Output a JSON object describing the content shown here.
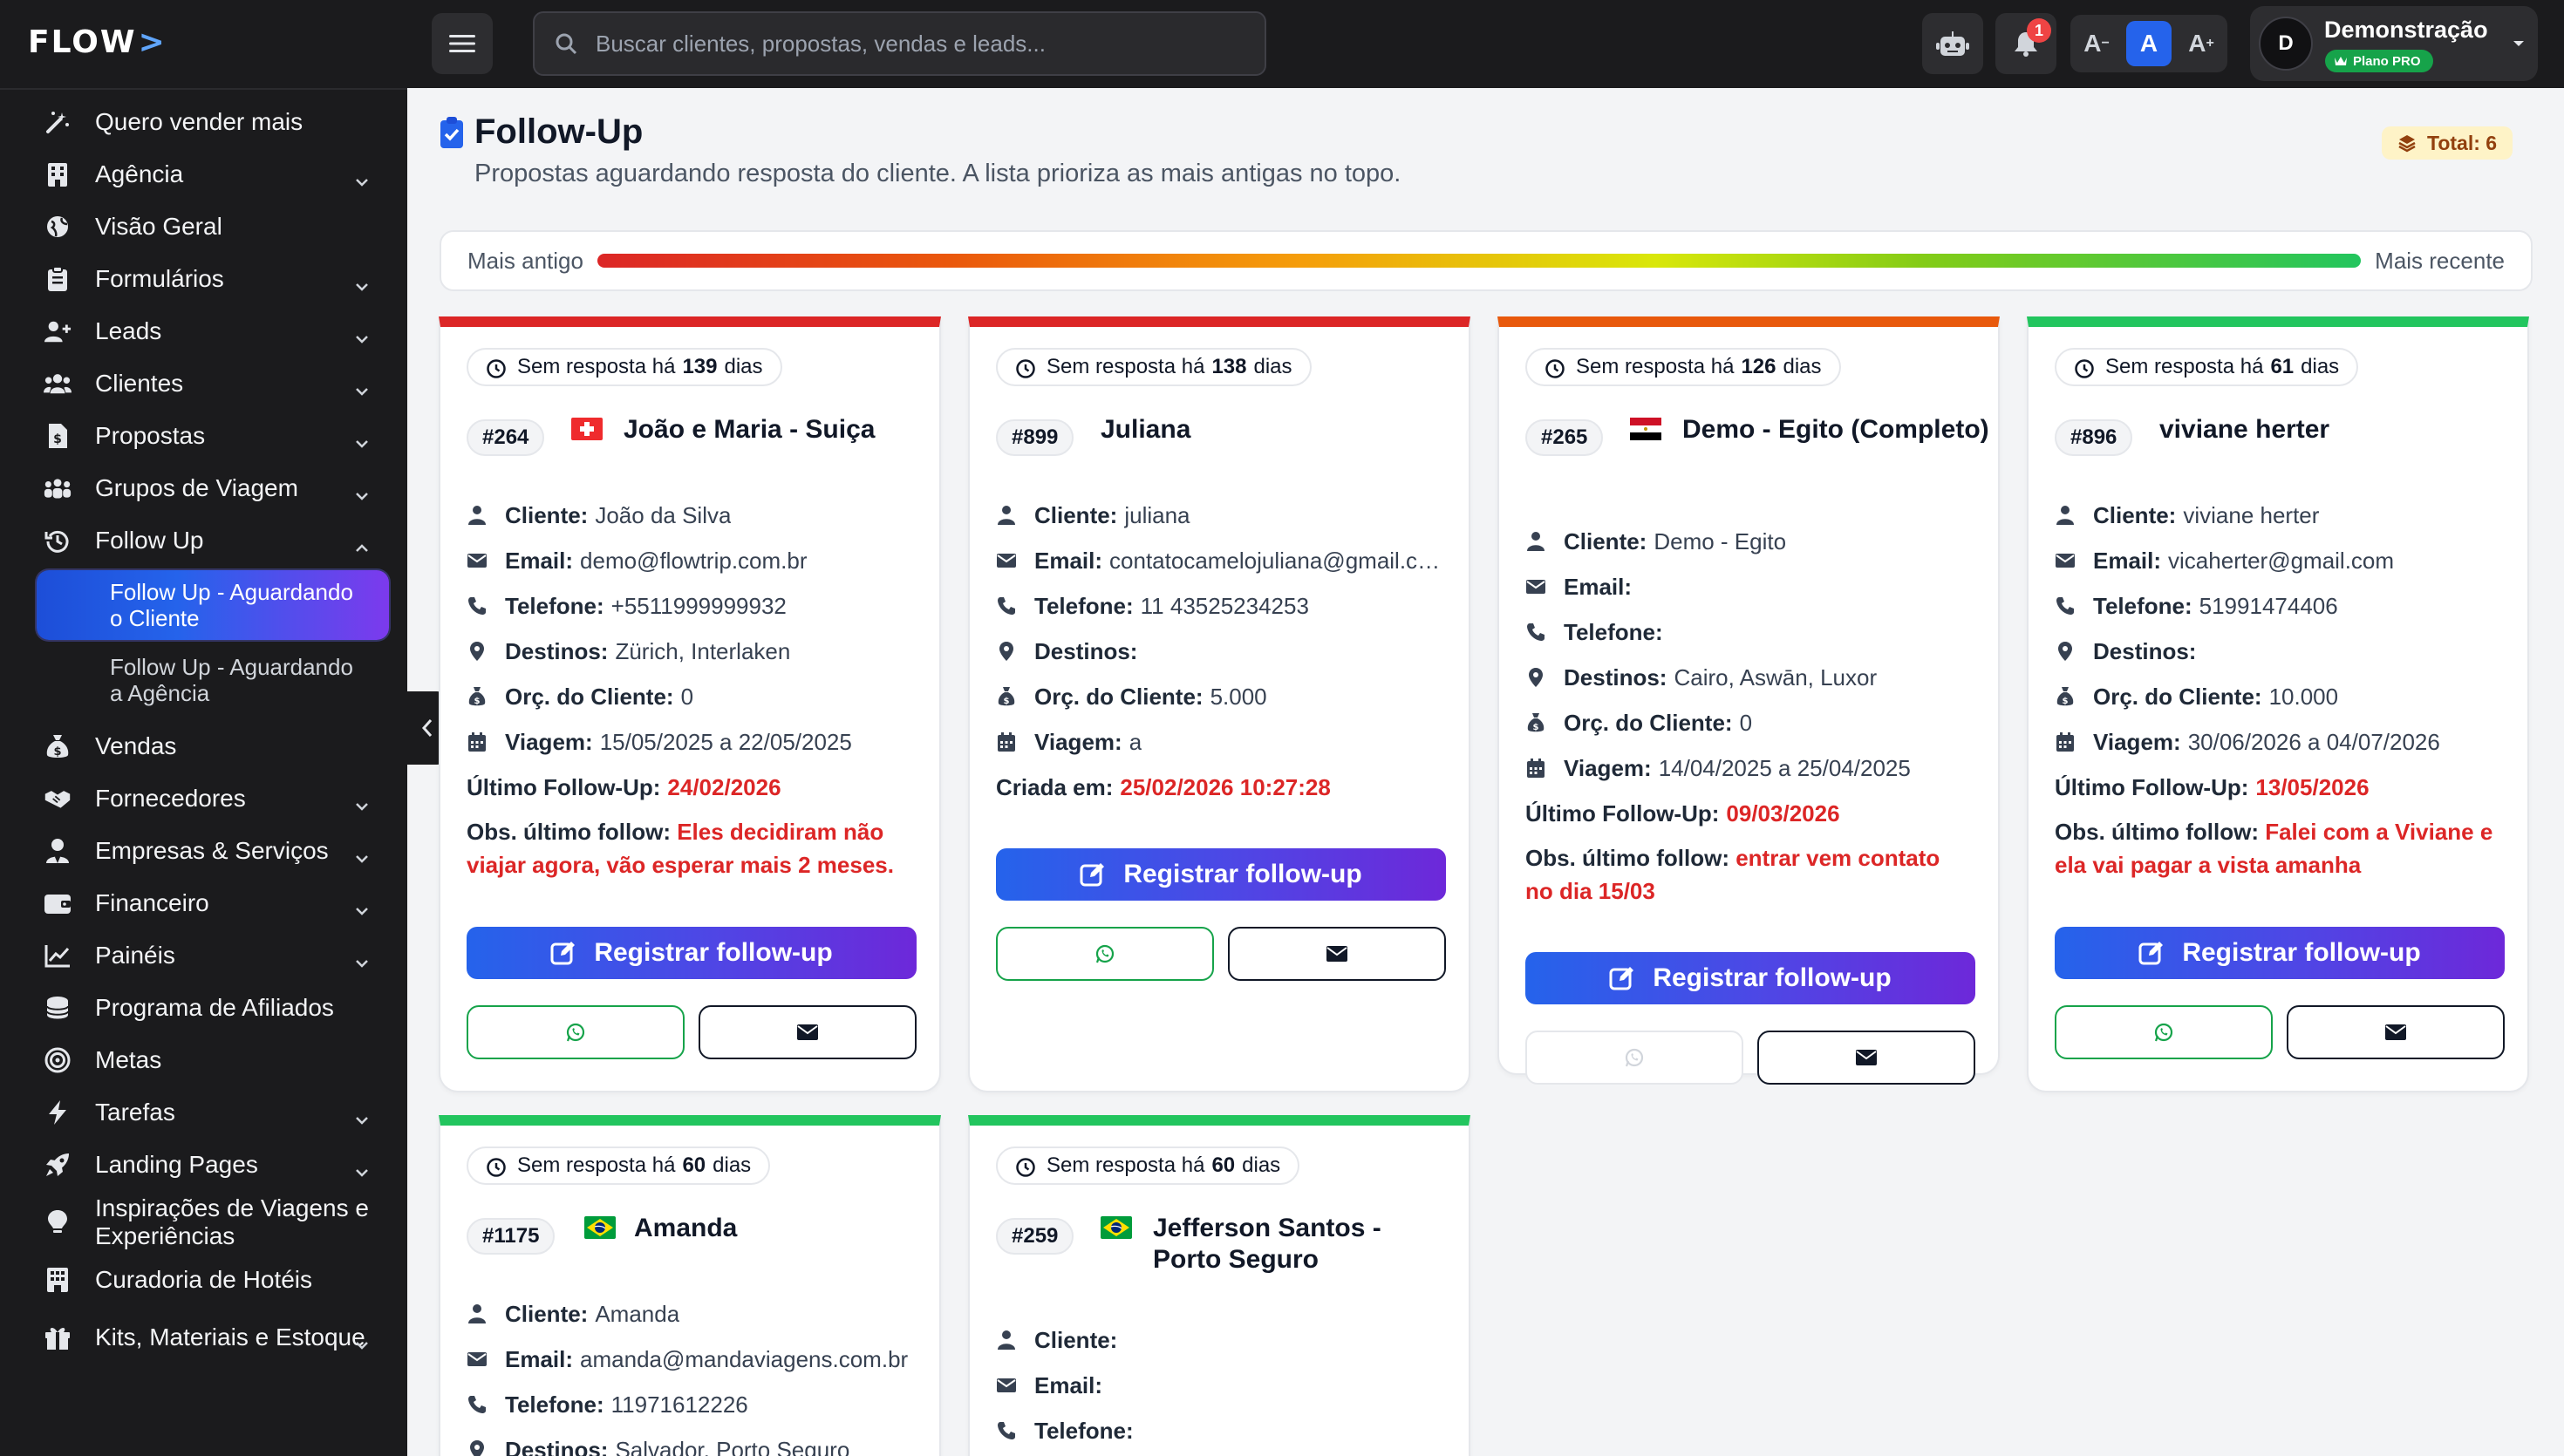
{
  "app": {
    "logo": "FLOW"
  },
  "sidebar": {
    "items": [
      {
        "label": "Quero vender mais",
        "icon": "magic-wand-icon",
        "caret": false
      },
      {
        "label": "Agência",
        "icon": "building-icon",
        "caret": true
      },
      {
        "label": "Visão Geral",
        "icon": "globe-icon",
        "caret": false
      },
      {
        "label": "Formulários",
        "icon": "clipboard-icon",
        "caret": true
      },
      {
        "label": "Leads",
        "icon": "user-plus-icon",
        "caret": true
      },
      {
        "label": "Clientes",
        "icon": "users-icon",
        "caret": true
      },
      {
        "label": "Propostas",
        "icon": "file-invoice-icon",
        "caret": true
      },
      {
        "label": "Grupos de Viagem",
        "icon": "people-group-icon",
        "caret": true
      },
      {
        "label": "Follow Up",
        "icon": "history-icon",
        "caret": true,
        "expanded": true
      }
    ],
    "followup_subitems": [
      {
        "label": "Follow Up - Aguardando o Cliente",
        "active": true
      },
      {
        "label": "Follow Up - Aguardando a Agência",
        "active": false
      }
    ],
    "items_after": [
      {
        "label": "Vendas",
        "icon": "money-bag-icon",
        "caret": false
      },
      {
        "label": "Fornecedores",
        "icon": "handshake-icon",
        "caret": true
      },
      {
        "label": "Empresas & Serviços",
        "icon": "user-tie-icon",
        "caret": true
      },
      {
        "label": "Financeiro",
        "icon": "wallet-icon",
        "caret": true
      },
      {
        "label": "Painéis",
        "icon": "chart-line-icon",
        "caret": true
      },
      {
        "label": "Programa de Afiliados",
        "icon": "coins-icon",
        "caret": false
      },
      {
        "label": "Metas",
        "icon": "target-icon",
        "caret": false
      },
      {
        "label": "Tarefas",
        "icon": "bolt-icon",
        "caret": true
      },
      {
        "label": "Landing Pages",
        "icon": "rocket-icon",
        "caret": true
      },
      {
        "label": "Inspirações de Viagens e Experiências",
        "icon": "lightbulb-icon",
        "caret": false,
        "tall": true
      },
      {
        "label": "Curadoria de Hotéis",
        "icon": "hotel-icon",
        "caret": false
      },
      {
        "label": "Kits, Materiais e Estoque",
        "icon": "gift-icon",
        "caret": true,
        "tall": true
      }
    ]
  },
  "topbar": {
    "search_placeholder": "Buscar clientes, propostas, vendas e leads...",
    "notifications_count": "1",
    "font_buttons": [
      "A",
      "A",
      "A"
    ],
    "font_sup": [
      "−",
      "",
      "+"
    ],
    "user": {
      "initial": "D",
      "name": "Demonstração",
      "plan": "Plano PRO"
    }
  },
  "page": {
    "title": "Follow-Up",
    "subtitle": "Propostas aguardando resposta do cliente. A lista prioriza as mais antigas no topo.",
    "total_label": "Total: 6",
    "age_bar": {
      "left": "Mais antigo",
      "right": "Mais recente"
    }
  },
  "labels": {
    "waiting_prefix": "Sem resposta há",
    "waiting_suffix": "dias",
    "cliente": "Cliente:",
    "email": "Email:",
    "telefone": "Telefone:",
    "destinos": "Destinos:",
    "orcamento": "Orç. do Cliente:",
    "viagem": "Viagem:",
    "ultimo_follow": "Último Follow-Up:",
    "criada_em": "Criada em:",
    "obs": "Obs. último follow:",
    "register_button": "Registrar follow-up"
  },
  "cards": [
    {
      "days": "139",
      "id": "#264",
      "flag": "switzerland",
      "title": "João e Maria - Suiça",
      "cliente": "João da Silva",
      "email": "demo@flowtrip.com.br",
      "telefone": "+5511999999932",
      "destinos": "Zürich, Interlaken",
      "orcamento": "0",
      "viagem": "15/05/2025 a 22/05/2025",
      "date_label": "Último Follow-Up:",
      "date_value": "24/02/2026",
      "obs": "Eles decidiram não viajar agora, vão esperar mais 2 meses.",
      "border_color": "#dc2626"
    },
    {
      "days": "138",
      "id": "#899",
      "flag": "",
      "title": "Juliana",
      "cliente": "juliana",
      "email": "contatocamelojuliana@gmail.com",
      "telefone": "11 43525234253",
      "destinos": "",
      "orcamento": "5.000",
      "viagem": "a",
      "date_label": "Criada em:",
      "date_value": "25/02/2026 10:27:28",
      "obs": "",
      "border_color": "#dc2626"
    },
    {
      "days": "126",
      "id": "#265",
      "flag": "egypt",
      "title": "Demo - Egito (Completo)",
      "cliente": "Demo - Egito",
      "email": "",
      "telefone": "",
      "destinos": "Cairo, Aswān, Luxor",
      "orcamento": "0",
      "viagem": "14/04/2025 a 25/04/2025",
      "date_label": "Último Follow-Up:",
      "date_value": "09/03/2026",
      "obs": "entrar vem contato no dia 15/03",
      "border_color": "#e8590c"
    },
    {
      "days": "61",
      "id": "#896",
      "flag": "",
      "title": "viviane herter",
      "cliente": "viviane herter",
      "email": "vicaherter@gmail.com",
      "telefone": "51991474406",
      "destinos": "",
      "orcamento": "10.000",
      "viagem": "30/06/2026 a 04/07/2026",
      "date_label": "Último Follow-Up:",
      "date_value": "13/05/2026",
      "obs": "Falei com a Viviane e ela vai pagar a vista amanha",
      "border_color": "#22c55e"
    },
    {
      "days": "60",
      "id": "#1175",
      "flag": "brazil",
      "title": "Amanda",
      "cliente": "Amanda",
      "email": "amanda@mandaviagens.com.br",
      "telefone": "11971612226",
      "destinos": "Salvador, Porto Seguro",
      "border_color": "#22c55e"
    },
    {
      "days": "60",
      "id": "#259",
      "flag": "brazil",
      "title": "Jefferson Santos - Porto Seguro",
      "cliente": "",
      "email": "",
      "telefone": "",
      "border_color": "#22c55e"
    }
  ],
  "colors": {
    "accent": "#2563eb",
    "danger": "#dc2626",
    "sidebar_bg": "#1b1b1d"
  }
}
